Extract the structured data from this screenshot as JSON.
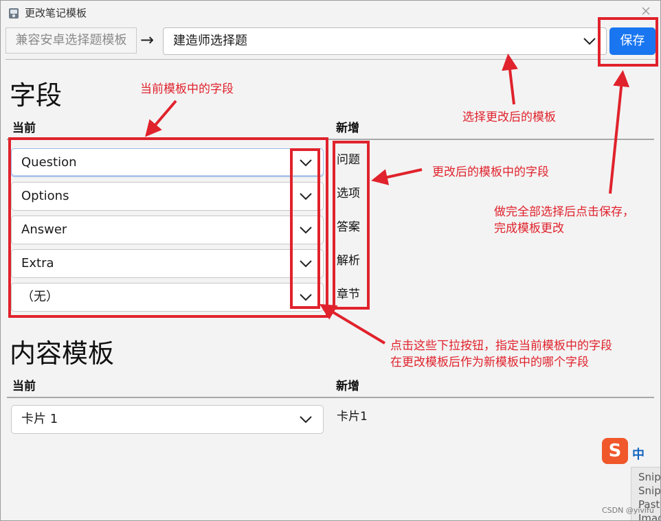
{
  "window": {
    "title": "更改笔记模板"
  },
  "toolbar": {
    "source_template": "兼容安卓选择题模板",
    "arrow": "→",
    "dest_template": "建造师选择题",
    "save_label": "保存"
  },
  "fields": {
    "heading": "字段",
    "current_header": "当前",
    "new_header": "新增",
    "current_selects": [
      "Question",
      "Options",
      "Answer",
      "Extra",
      "（无）"
    ],
    "new_fields": [
      "问题",
      "选项",
      "答案",
      "解析",
      "章节"
    ]
  },
  "templates": {
    "heading": "内容模板",
    "current_header": "当前",
    "new_header": "新增",
    "current_select": "卡片 1",
    "new_value": "卡片1"
  },
  "annotations": {
    "current_fields": "当前模板中的字段",
    "choose_template": "选择更改后的模板",
    "new_fields": "更改后的模板中的字段",
    "save_hint_line1": "做完全部选择后点击保存，",
    "save_hint_line2": "完成模板更改",
    "dropdown_hint_line1": "点击这些下拉按钮，指定当前模板中的字段",
    "dropdown_hint_line2": "在更改模板后作为新模板中的哪个字段",
    "color": "#e0222c"
  },
  "overlays": {
    "ime_logo": "S",
    "ime_mode": "中",
    "snip_items": [
      "Snipa",
      "Snip",
      "Paste",
      "Imag"
    ],
    "watermark": "CSDN @yivifu"
  },
  "colors": {
    "accent": "#1976f0"
  }
}
